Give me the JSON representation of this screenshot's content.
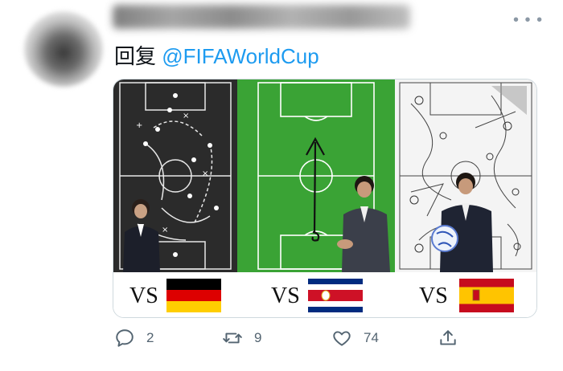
{
  "tweet": {
    "reply_label": "回复",
    "mention": "@FIFAWorldCup"
  },
  "media": {
    "panels": [
      {
        "vs_label": "VS",
        "flag": "germany"
      },
      {
        "vs_label": "VS",
        "flag": "costa-rica"
      },
      {
        "vs_label": "VS",
        "flag": "spain"
      }
    ]
  },
  "actions": {
    "reply_count": "2",
    "retweet_count": "9",
    "like_count": "74"
  },
  "icons": [
    "more-icon",
    "reply-icon",
    "retweet-icon",
    "like-icon",
    "share-icon"
  ],
  "colors": {
    "mention": "#1d9bf0",
    "muted": "#536471",
    "pitch_green": "#3aa335"
  }
}
